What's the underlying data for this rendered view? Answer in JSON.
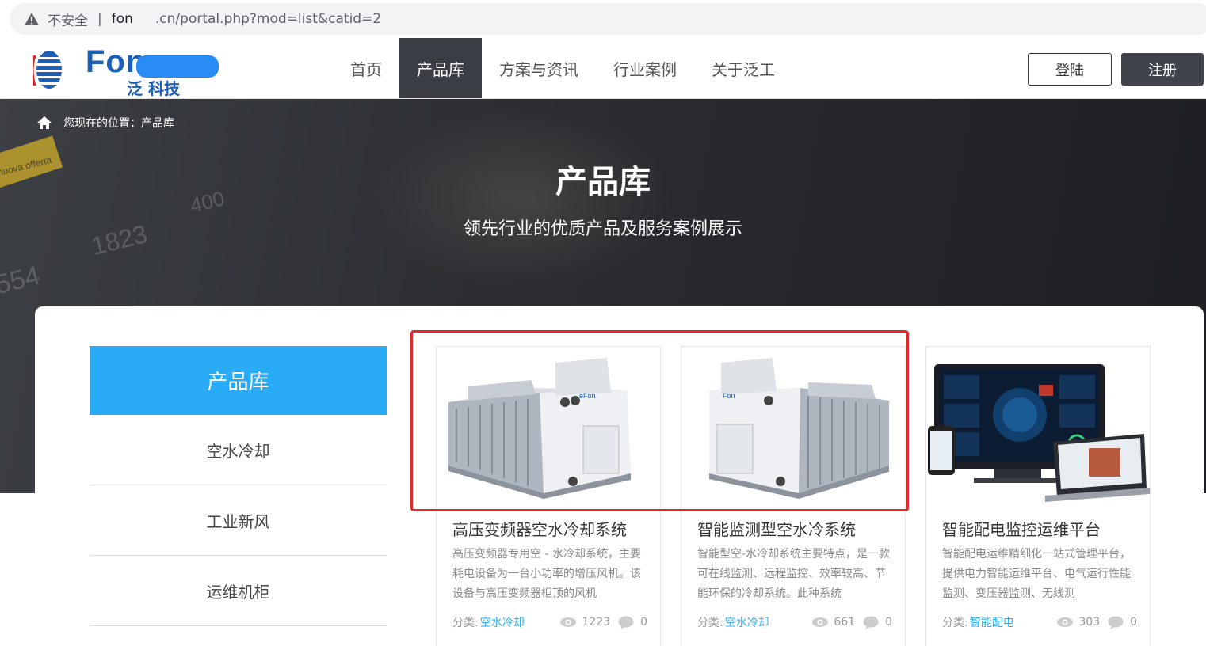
{
  "browser": {
    "security_label": "不安全",
    "separator": "|",
    "url_host_start": "fon",
    "url_rest": ".cn/portal.php?mod=list&catid=2"
  },
  "header": {
    "logo_text": "Fon",
    "logo_sub": "泛  科技",
    "nav": [
      {
        "label": "首页",
        "active": false
      },
      {
        "label": "产品库",
        "active": true
      },
      {
        "label": "方案与资讯",
        "active": false
      },
      {
        "label": "行业案例",
        "active": false
      },
      {
        "label": "关于泛工",
        "active": false
      }
    ],
    "login_label": "登陆",
    "register_label": "注册"
  },
  "hero": {
    "breadcrumb": "您现在的位置：产品库",
    "title": "产品库",
    "subtitle": "领先行业的优质产品及服务案例展示",
    "deco_texts": [
      "1823",
      "400",
      "554",
      "nuova offerta"
    ]
  },
  "sidebar": {
    "heading": "产品库",
    "items": [
      {
        "label": "空水冷却"
      },
      {
        "label": "工业新风"
      },
      {
        "label": "运维机柜"
      }
    ]
  },
  "cards": [
    {
      "title": "高压变频器空水冷却系统",
      "desc": "高压变频器专用空 - 水冷却系统，主要耗电设备为一台小功率的增压风机。该设备与高压变频器柜顶的风机",
      "category_label": "分类:",
      "category": "空水冷却",
      "views": "1223",
      "comments": "0",
      "image": "air-water-cooling-unit"
    },
    {
      "title": "智能监测型空水冷系统",
      "desc": "智能型空-水冷却系统主要特点，是一款可在线监测、远程监控、效率较高、节能环保的冷却系统。此种系统",
      "category_label": "分类:",
      "category": "空水冷却",
      "views": "661",
      "comments": "0",
      "image": "smart-air-water-cooling-unit"
    },
    {
      "title": "智能配电监控运维平台",
      "desc": "智能配电运维精细化一站式管理平台，提供电力智能运维平台、电气运行性能监测、变压器监测、无线测",
      "category_label": "分类:",
      "category": "智能配电",
      "views": "303",
      "comments": "0",
      "image": "monitoring-platform-devices"
    }
  ],
  "colors": {
    "accent": "#2aabf7",
    "nav_active_bg": "#3a3e44",
    "highlight": "#e32a2a"
  }
}
